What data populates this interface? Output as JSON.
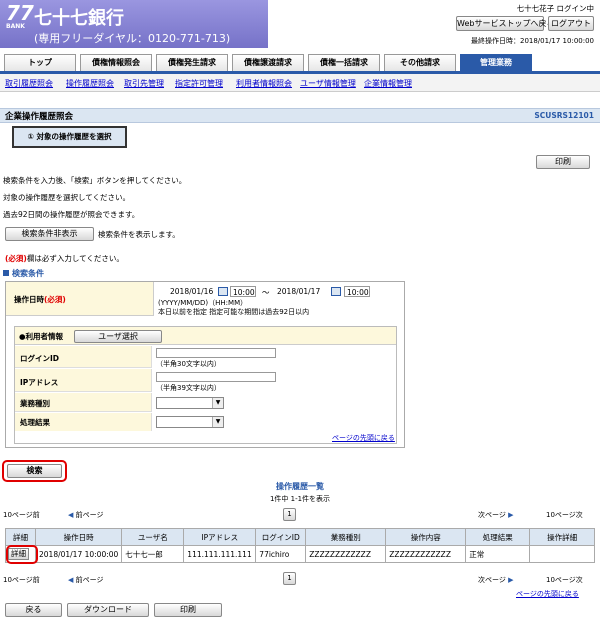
{
  "header": {
    "logo_number": "77",
    "logo_sub": "BANK",
    "bank_name": "七十七銀行",
    "dial": "(専用フリーダイヤル：0120-771-713)",
    "user_status": "七十七花子 ログイン中",
    "websvc_top_button": "Webサービストップへ戻る",
    "logout_button": "ログアウト",
    "last_login": "最終操作日時：2018/01/17 10:00:00"
  },
  "tabs": [
    {
      "label": "トップ"
    },
    {
      "label": "債権情報照会"
    },
    {
      "label": "債権発生請求"
    },
    {
      "label": "債権譲渡請求"
    },
    {
      "label": "債権一括請求"
    },
    {
      "label": "その他請求"
    },
    {
      "label": "管理業務"
    }
  ],
  "subnav": [
    "取引履歴照会",
    "操作履歴照会",
    "取引先管理",
    "指定許可管理",
    "利用者情報照会",
    "ユーザ情報管理",
    "企業情報管理"
  ],
  "page": {
    "title": "企業操作履歴照会",
    "screen_id": "SCUSRS12101",
    "step": "① 対象の操作履歴を選択",
    "print_button": "印刷",
    "instr1": "検索条件を入力後、「検索」ボタンを押してください。",
    "instr2": "対象の操作履歴を選択してください。",
    "instr3": "過去92日間の操作履歴が照会できます。",
    "toggle_button": "検索条件非表示",
    "toggle_note": "検索条件を表示します。",
    "required_mark": "(必須)",
    "required_note": "欄は必ず入力してください。",
    "section_title": "検索条件"
  },
  "form": {
    "date_label": "操作日時",
    "date_required": "(必須)",
    "date_from": "2018/01/16",
    "time_from": "10:00",
    "tilde": "〜",
    "date_to": "2018/01/17",
    "time_to": "10:00",
    "date_format": "(YYYY/MM/DD)（HH:MM）",
    "date_note": "本日以前を指定 指定可能な期間は過去92日以内",
    "user_info_label": "●利用者情報",
    "user_select_button": "ユーザ選択",
    "login_id_label": "ログインID",
    "login_id_hint": "（半角30文字以内）",
    "ip_label": "IPアドレス",
    "ip_hint": "（半角39文字以内）",
    "biz_type_label": "業務種別",
    "result_label": "処理結果",
    "page_top_link": "ページの先頭に戻る",
    "search_button": "検索"
  },
  "results": {
    "title": "操作履歴一覧",
    "count": "1件中 1-1件を表示",
    "prev10": "10ページ前",
    "prev": "前ページ",
    "page_num": "1",
    "next": "次ページ",
    "next10": "10ページ次",
    "columns": [
      "詳細",
      "操作日時",
      "ユーザ名",
      "IPアドレス",
      "ログインID",
      "業務種別",
      "操作内容",
      "処理結果",
      "操作詳細"
    ],
    "rows": [
      {
        "detail": "詳細",
        "datetime": "2018/01/17 10:00:00",
        "user": "七十七一郎",
        "ip": "111.111.111.111",
        "login_id": "77ichiro",
        "biz": "ZZZZZZZZZZZZ",
        "op": "ZZZZZZZZZZZZ",
        "result": "正常",
        "op_detail": ""
      }
    ],
    "page_top_link": "ページの先頭に戻る"
  },
  "footer": {
    "back_button": "戻る",
    "download_button": "ダウンロード",
    "print_button": "印刷"
  },
  "colors": {
    "header_bg": "#8a86d6",
    "tab_active": "#2a5aa8",
    "title_bar": "#dbe6f2",
    "highlight": "#e00000",
    "form_bg": "#fdf8dc"
  }
}
